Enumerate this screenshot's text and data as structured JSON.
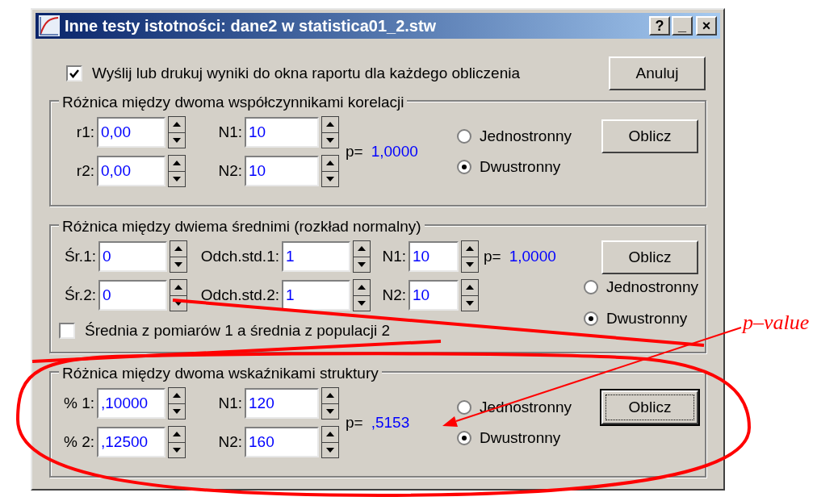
{
  "window": {
    "title": "Inne testy istotności: dane2 w statistica01_2.stw",
    "controls": [
      "?",
      "_",
      "×"
    ]
  },
  "report_option": {
    "label": "Wyślij lub drukuj wyniki do okna raportu dla każdego obliczenia",
    "checked": true
  },
  "cancel_button": "Anuluj",
  "groups": [
    {
      "kind": "pair",
      "title": "Różnica między dwoma współczynnikami korelacji",
      "rows": [
        [
          {
            "label": "r1:",
            "value": "0,00"
          },
          {
            "label": "N1:",
            "value": "10"
          }
        ],
        [
          {
            "label": "r2:",
            "value": "0,00"
          },
          {
            "label": "N2:",
            "value": "10"
          }
        ]
      ],
      "p_label": "p=",
      "p_value": "1,0000",
      "options": [
        {
          "label": "Jednostronny",
          "selected": false
        },
        {
          "label": "Dwustronny",
          "selected": true
        }
      ],
      "button": {
        "label": "Oblicz",
        "focused": false
      }
    },
    {
      "kind": "triple",
      "title": "Różnica między dwiema średnimi (rozkład normalny)",
      "rows": [
        [
          {
            "label": "Śr.1:",
            "value": "0"
          },
          {
            "label": "Odch.std.1:",
            "value": "1"
          },
          {
            "label": "N1:",
            "value": "10"
          }
        ],
        [
          {
            "label": "Śr.2:",
            "value": "0"
          },
          {
            "label": "Odch.std.2:",
            "value": "1"
          },
          {
            "label": "N2:",
            "value": "10"
          }
        ]
      ],
      "p_label": "p=",
      "p_value": "1,0000",
      "options": [
        {
          "label": "Jednostronny",
          "selected": false
        },
        {
          "label": "Dwustronny",
          "selected": true
        }
      ],
      "button": {
        "label": "Oblicz",
        "focused": false
      },
      "checkbox": {
        "label": "Średnia z pomiarów 1 a średnia z populacji 2",
        "checked": false
      }
    },
    {
      "kind": "pair",
      "title": "Różnica między dwoma wskaźnikami struktury",
      "rows": [
        [
          {
            "label": "% 1:",
            "value": ",10000"
          },
          {
            "label": "N1:",
            "value": "120"
          }
        ],
        [
          {
            "label": "% 2:",
            "value": ",12500"
          },
          {
            "label": "N2:",
            "value": "160"
          }
        ]
      ],
      "p_label": "p=",
      "p_value": ",5153",
      "options": [
        {
          "label": "Jednostronny",
          "selected": false
        },
        {
          "label": "Dwustronny",
          "selected": true
        }
      ],
      "button": {
        "label": "Oblicz",
        "focused": true
      }
    }
  ],
  "annotation": {
    "label": "p–value"
  }
}
